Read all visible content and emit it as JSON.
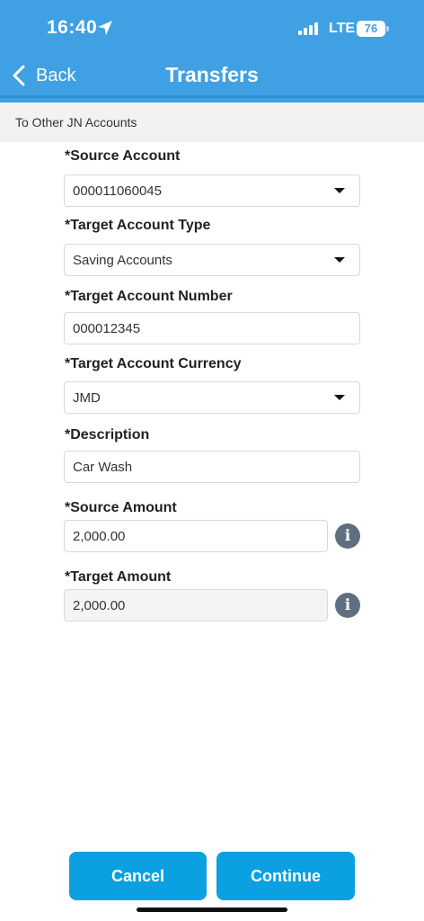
{
  "status_bar": {
    "time": "16:40",
    "network": "LTE",
    "battery": "76",
    "icons": [
      "location-arrow-icon",
      "signal-bars-icon",
      "battery-icon"
    ]
  },
  "nav": {
    "back_label": "Back",
    "title": "Transfers"
  },
  "subheader": "To Other JN Accounts",
  "form": {
    "source_account": {
      "label": "*Source Account",
      "value": "000011060045"
    },
    "target_account_type": {
      "label": "*Target Account Type",
      "value": "Saving Accounts"
    },
    "target_account_number": {
      "label": "*Target Account Number",
      "value": "000012345"
    },
    "target_account_currency": {
      "label": "*Target Account Currency",
      "value": "JMD"
    },
    "description": {
      "label": "*Description",
      "value": "Car Wash"
    },
    "source_amount": {
      "label": "*Source Amount",
      "value": "2,000.00"
    },
    "target_amount": {
      "label": "*Target Amount",
      "value": "2,000.00"
    },
    "info_glyph": "i"
  },
  "actions": {
    "cancel_label": "Cancel",
    "continue_label": "Continue"
  },
  "colors": {
    "header": "#3fa1e3",
    "button": "#0aa0e2",
    "info_icon": "#5f6f7f"
  }
}
